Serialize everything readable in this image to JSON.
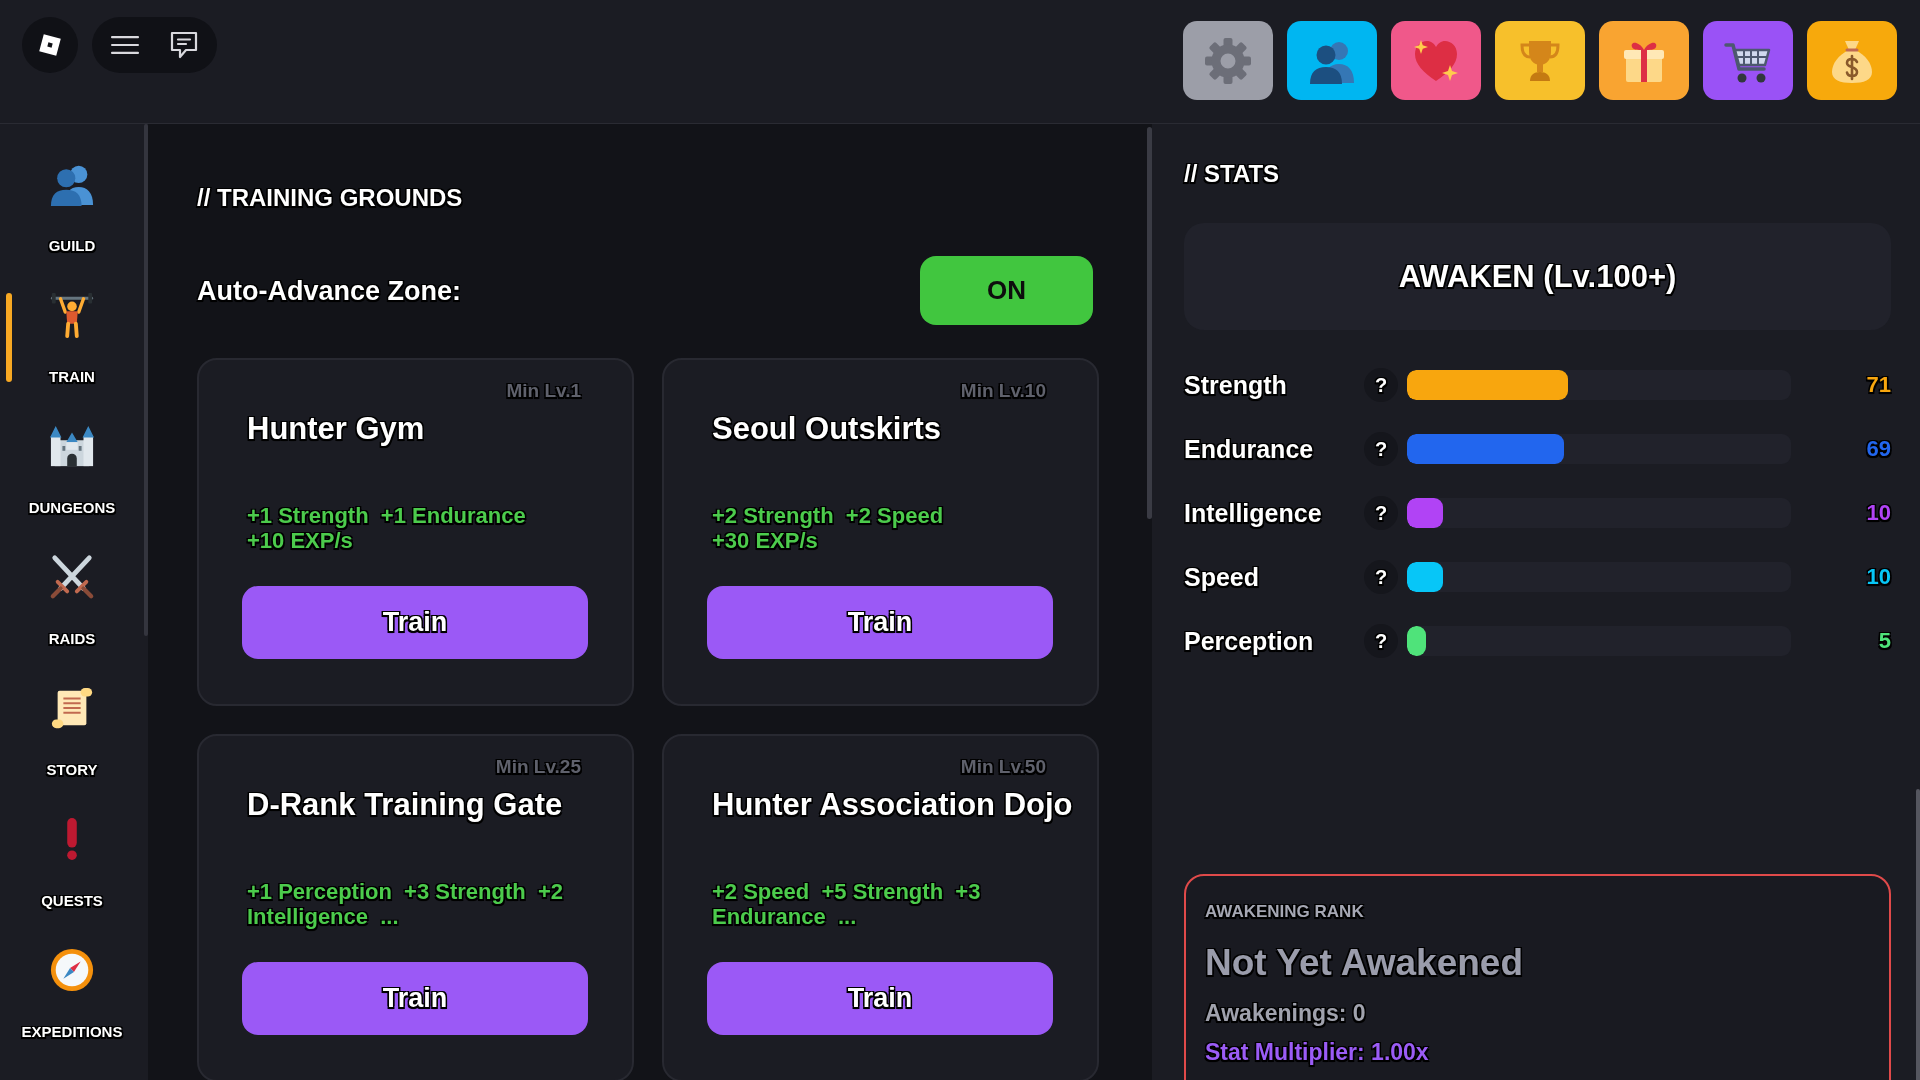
{
  "toolbar": [
    {
      "kind": "settings",
      "color": "#9c9ea8"
    },
    {
      "kind": "friends",
      "color": "#00b6f1"
    },
    {
      "kind": "favorites",
      "color": "#f0588a"
    },
    {
      "kind": "trophy",
      "color": "#f7c02b"
    },
    {
      "kind": "gift",
      "color": "#f9a431"
    },
    {
      "kind": "shop",
      "color": "#9a52f6"
    },
    {
      "kind": "money",
      "color": "#f7a90c"
    }
  ],
  "sidebar": {
    "items": [
      {
        "label": "GUILD",
        "kind": "guild",
        "selected": false
      },
      {
        "label": "TRAIN",
        "kind": "train",
        "selected": true
      },
      {
        "label": "DUNGEONS",
        "kind": "dungeons",
        "selected": false
      },
      {
        "label": "RAIDS",
        "kind": "raids",
        "selected": false
      },
      {
        "label": "STORY",
        "kind": "story",
        "selected": false
      },
      {
        "label": "QUESTS",
        "kind": "quests",
        "selected": false
      },
      {
        "label": "EXPEDITIONS",
        "kind": "expeditions",
        "selected": false
      }
    ]
  },
  "training_grounds": {
    "title": "// TRAINING GROUNDS",
    "auto_advance": {
      "label": "Auto-Advance Zone:",
      "toggle": "ON",
      "on": true
    },
    "zones": [
      {
        "name": "Hunter Gym",
        "min_level": "Min Lv.1",
        "bonuses": "+1 Strength  +1 Endurance",
        "exp": "+10 EXP/s",
        "button": "Train"
      },
      {
        "name": "Seoul Outskirts",
        "min_level": "Min Lv.10",
        "bonuses": "+2 Strength  +2 Speed",
        "exp": "+30 EXP/s",
        "button": "Train"
      },
      {
        "name": "D-Rank Training Gate",
        "min_level": "Min Lv.25",
        "bonuses": "+1 Perception  +3 Strength  +2 Intelligence  ...",
        "button": "Train"
      },
      {
        "name": "Hunter Association Dojo",
        "min_level": "Min Lv.50",
        "bonuses": "+2 Speed  +5 Strength  +3 Endurance  ...",
        "button": "Train"
      }
    ]
  },
  "stats": {
    "title": "// STATS",
    "awaken_button": "AWAKEN (Lv.100+)",
    "rows": [
      {
        "name": "Strength",
        "help": "?",
        "level": 0.418,
        "value": "71",
        "color": "#f8a60e"
      },
      {
        "name": "Endurance",
        "help": "?",
        "level": 0.409,
        "value": "69",
        "color": "#2266ee"
      },
      {
        "name": "Intelligence",
        "help": "?",
        "level": 0.093,
        "value": "10",
        "color": "#b143f5"
      },
      {
        "name": "Speed",
        "help": "?",
        "level": 0.093,
        "value": "10",
        "color": "#07c6f7"
      },
      {
        "name": "Perception",
        "help": "?",
        "level": 0.05,
        "value": "5",
        "color": "#4fe37a"
      }
    ]
  },
  "awakening_rank": {
    "label": "AWAKENING RANK",
    "rank": "Not Yet Awakened",
    "awakenings": "Awakenings: 0",
    "multiplier": "Stat Multiplier: 1.00x"
  }
}
